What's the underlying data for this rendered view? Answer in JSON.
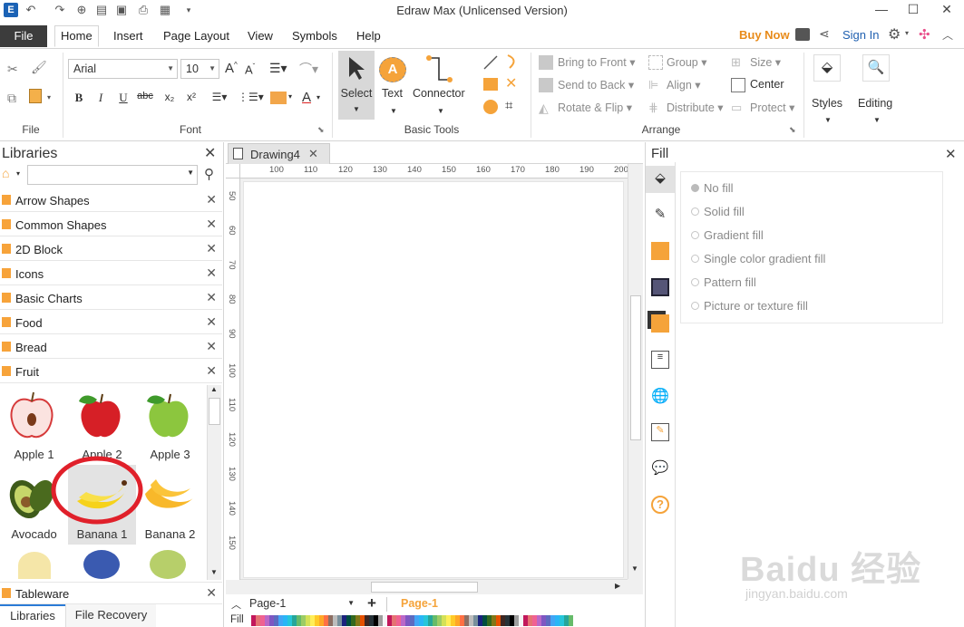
{
  "window": {
    "title": "Edraw Max (Unlicensed Version)"
  },
  "ribbon_tabs": {
    "file": "File",
    "tabs": [
      "Home",
      "Insert",
      "Page Layout",
      "View",
      "Symbols",
      "Help"
    ],
    "buy_now": "Buy Now",
    "sign_in": "Sign In"
  },
  "ribbon": {
    "file_group": "File",
    "font_group": "Font",
    "font_name": "Arial",
    "font_size": "10",
    "basic_tools_group": "Basic Tools",
    "select": "Select",
    "text": "Text",
    "connector": "Connector",
    "arrange_group": "Arrange",
    "bring_to_front": "Bring to Front",
    "send_to_back": "Send to Back",
    "rotate_flip": "Rotate & Flip",
    "group": "Group",
    "align": "Align",
    "distribute": "Distribute",
    "size": "Size",
    "center": "Center",
    "protect": "Protect",
    "styles": "Styles",
    "editing": "Editing"
  },
  "libraries": {
    "title": "Libraries",
    "items": [
      "Arrow Shapes",
      "Common Shapes",
      "2D Block",
      "Icons",
      "Basic Charts",
      "Food",
      "Bread",
      "Fruit"
    ],
    "shapes": [
      "Apple 1",
      "Apple 2",
      "Apple 3",
      "Avocado",
      "Banana 1",
      "Banana 2"
    ],
    "tableware": "Tableware",
    "bottom_tabs": [
      "Libraries",
      "File Recovery"
    ]
  },
  "document": {
    "tab": "Drawing4",
    "ruler_h": [
      "100",
      "110",
      "120",
      "130",
      "140",
      "150",
      "160",
      "170",
      "180",
      "190",
      "200"
    ],
    "ruler_v": [
      "50",
      "60",
      "70",
      "80",
      "90",
      "100",
      "110",
      "120",
      "130",
      "140",
      "150"
    ],
    "page_select": "Page-1",
    "page_tab": "Page-1",
    "fill_label": "Fill"
  },
  "fill_pane": {
    "title": "Fill",
    "options": [
      "No fill",
      "Solid fill",
      "Gradient fill",
      "Single color gradient fill",
      "Pattern fill",
      "Picture or texture fill"
    ]
  },
  "watermark": "Baidu经验 jingyan.baidu.com",
  "colors": {
    "accent": "#f7a33a",
    "buy_now": "#e88b1a",
    "file_tab": "#3c3c3c",
    "annotation_circle": "#e0202a"
  }
}
